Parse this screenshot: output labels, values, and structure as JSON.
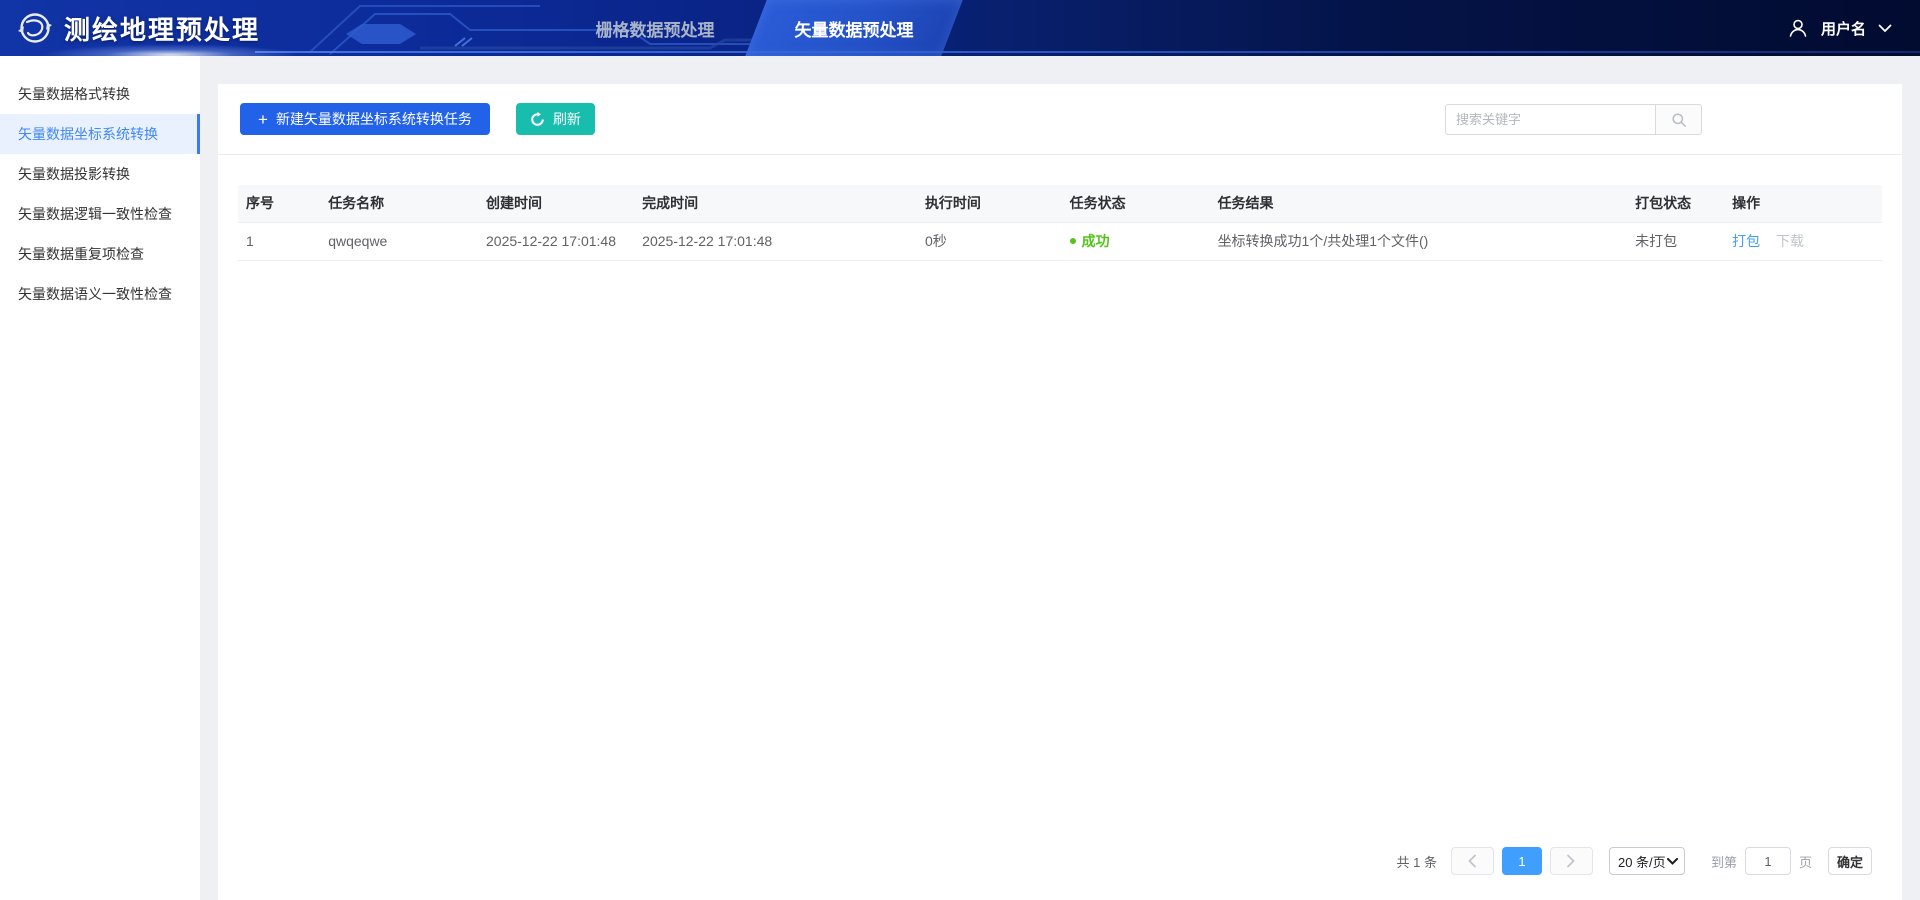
{
  "header": {
    "app_title": "测绘地理预处理",
    "tabs": [
      {
        "label": "栅格数据预处理",
        "active": false
      },
      {
        "label": "矢量数据预处理",
        "active": true
      }
    ],
    "user": {
      "name": "用户名"
    }
  },
  "sidebar": {
    "items": [
      {
        "label": "矢量数据格式转换",
        "active": false
      },
      {
        "label": "矢量数据坐标系统转换",
        "active": true
      },
      {
        "label": "矢量数据投影转换",
        "active": false
      },
      {
        "label": "矢量数据逻辑一致性检查",
        "active": false
      },
      {
        "label": "矢量数据重复项检查",
        "active": false
      },
      {
        "label": "矢量数据语义一致性检查",
        "active": false
      }
    ]
  },
  "toolbar": {
    "new_task_label": "新建矢量数据坐标系统转换任务",
    "refresh_label": "刷新",
    "search_placeholder": "搜索关键字"
  },
  "table": {
    "columns": [
      "序号",
      "任务名称",
      "创建时间",
      "完成时间",
      "执行时间",
      "任务状态",
      "任务结果",
      "打包状态",
      "操作"
    ],
    "rows": [
      {
        "index": "1",
        "task_name": "qwqeqwe",
        "created_at": "2025-12-22 17:01:48",
        "finished_at": "2025-12-22 17:01:48",
        "duration": "0秒",
        "status": "成功",
        "result": "坐标转换成功1个/共处理1个文件()",
        "package_status": "未打包",
        "action_package": "打包",
        "action_download": "下载"
      }
    ]
  },
  "pagination": {
    "total_label": "共 1 条",
    "current_page": "1",
    "page_size_label": "20 条/页",
    "goto_prefix": "到第",
    "goto_value": "1",
    "goto_suffix": "页",
    "confirm_label": "确定"
  },
  "colors": {
    "primary_button": "#2162e8",
    "refresh_button": "#19bdad",
    "link": "#409eff",
    "status_success": "#52c41a",
    "header_left": "#1134a6",
    "header_right": "#020b30",
    "active_tab": "#2452c8",
    "sidebar_active_bg": "#e8f1fd",
    "pagination_active": "#409eff"
  }
}
